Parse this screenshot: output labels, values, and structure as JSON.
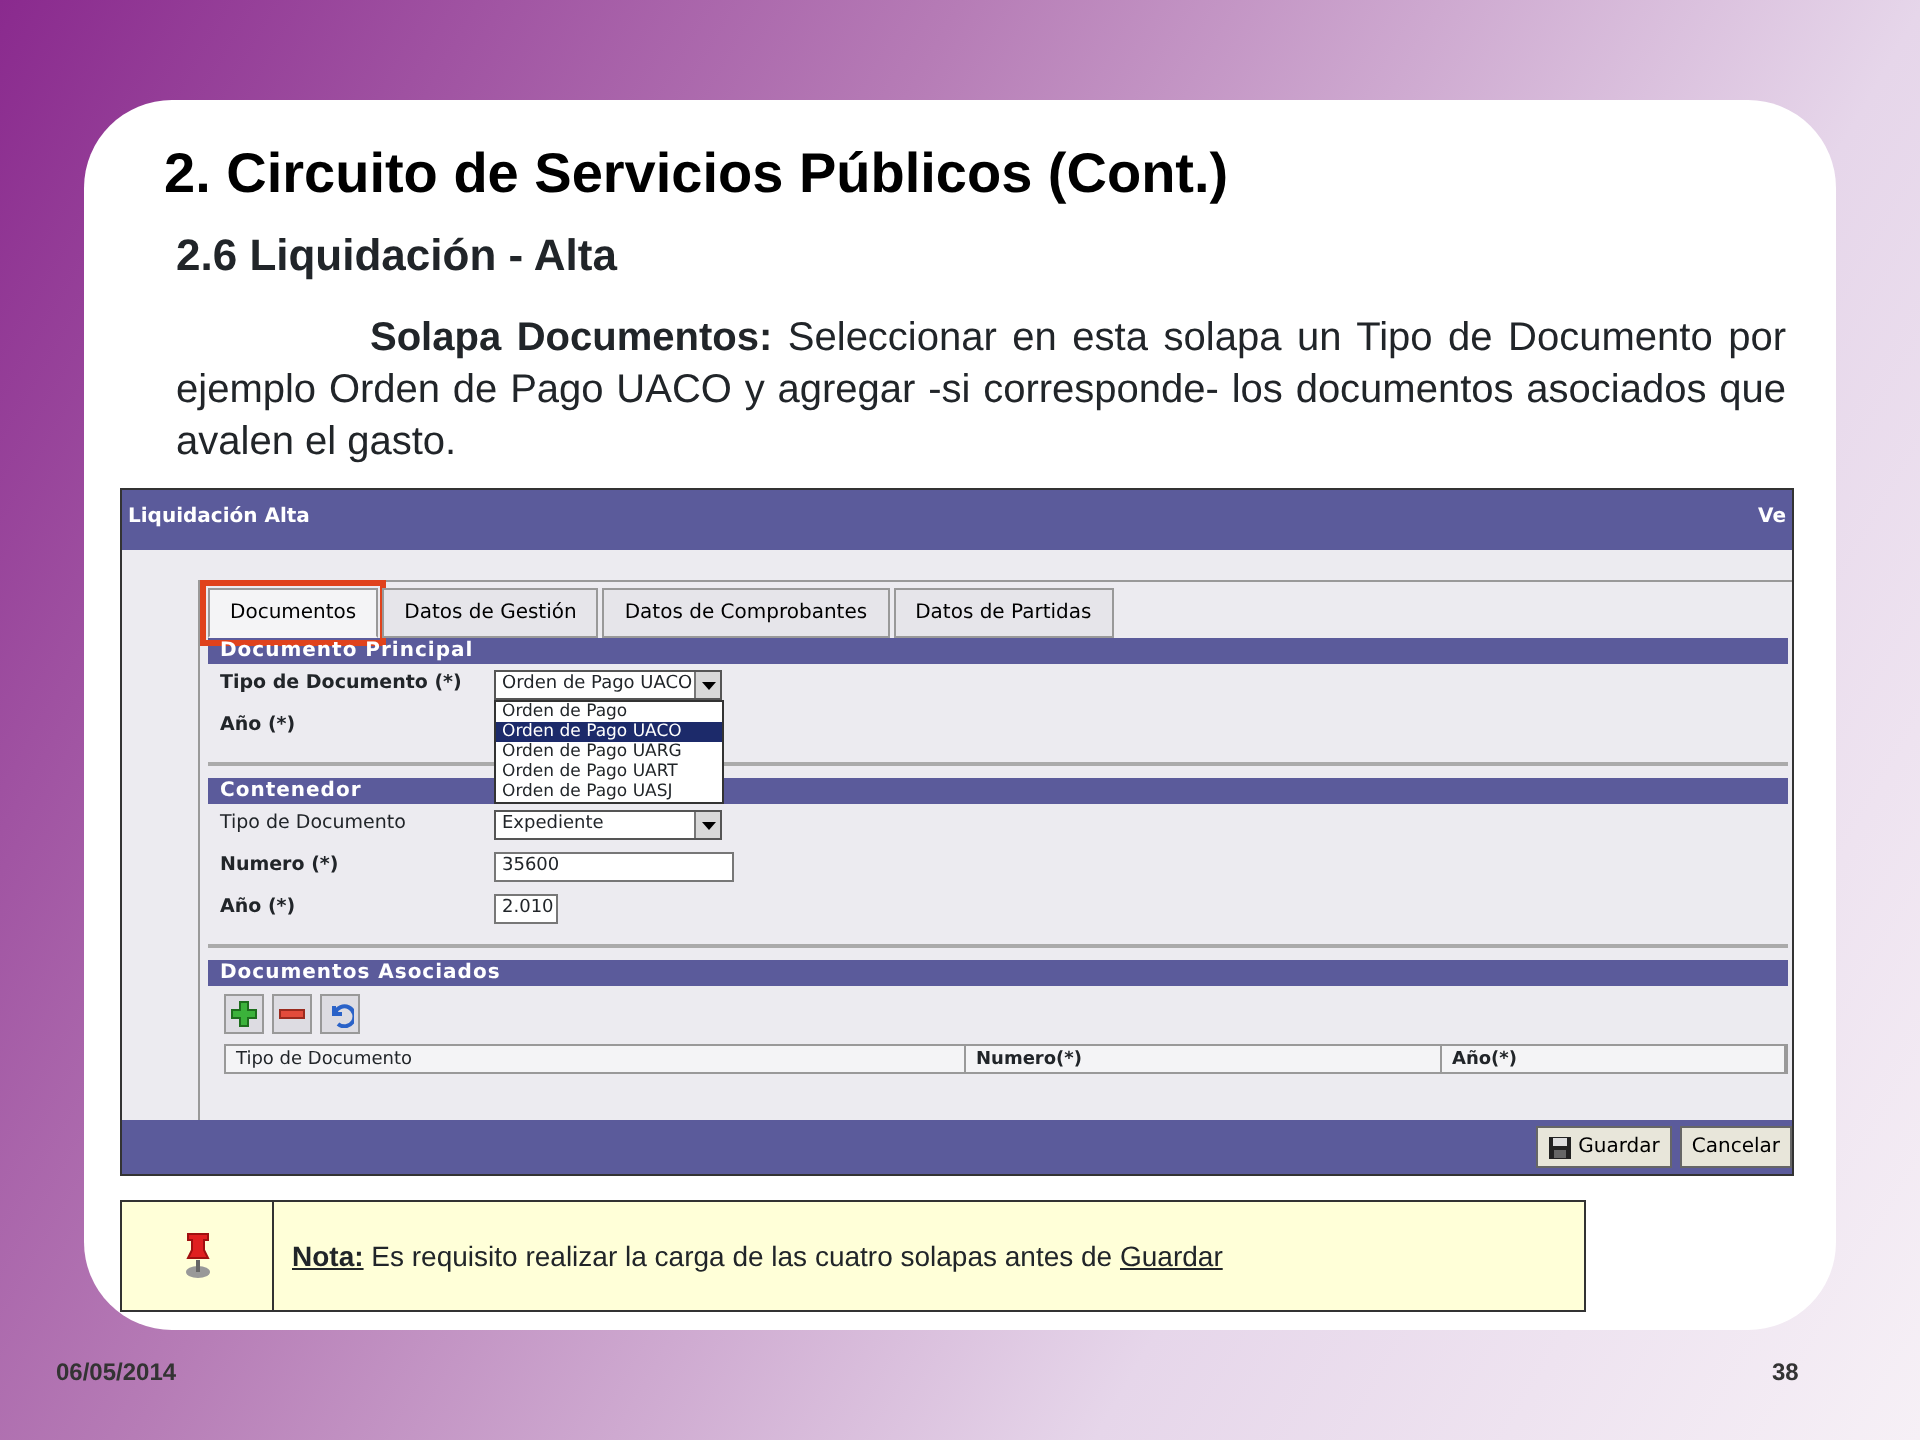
{
  "slide": {
    "title": "2. Circuito de Servicios Públicos (Cont.)",
    "subtitle": "2.6 Liquidación - Alta",
    "paragraph": "**Solapa Documentos:** Seleccionar en esta solapa un Tipo de Documento por ejemplo Orden de Pago UACO y agregar -si corresponde- los documentos asociados que avalen el gasto."
  },
  "app": {
    "title": "Liquidación Alta",
    "title_right": "Ve",
    "tabs": [
      {
        "label": "Documentos",
        "selected": true,
        "highlighted": true
      },
      {
        "label": "Datos de Gestión",
        "selected": false,
        "highlighted": false
      },
      {
        "label": "Datos de Comprobantes",
        "selected": false,
        "highlighted": false
      },
      {
        "label": "Datos de Partidas",
        "selected": false,
        "highlighted": false
      }
    ],
    "documento_principal": {
      "header": "Documento Principal",
      "fields": [
        {
          "kind": "select",
          "label": "Tipo de Documento (*)",
          "bold": true,
          "value": "Orden de Pago UACO",
          "open": true,
          "options": [
            {
              "label": "Orden de Pago",
              "selected": false
            },
            {
              "label": "Orden de Pago UACO",
              "selected": true
            },
            {
              "label": "Orden de Pago UARG",
              "selected": false
            },
            {
              "label": "Orden de Pago UART",
              "selected": false
            },
            {
              "label": "Orden de Pago UASJ",
              "selected": false
            }
          ]
        },
        {
          "kind": "empty",
          "label": "Año (*)",
          "bold": true
        }
      ]
    },
    "contenedor": {
      "header": "Contenedor",
      "fields": [
        {
          "kind": "select",
          "label": "Tipo de Documento",
          "bold": false,
          "value": "Expediente",
          "open": false
        },
        {
          "kind": "input",
          "label": "Numero (*)",
          "bold": true,
          "value": "35600"
        },
        {
          "kind": "input",
          "label": "Año (*)",
          "bold": true,
          "value": "2.010"
        }
      ]
    },
    "documentos_asociados": {
      "header": "Documentos Asociados",
      "toolbar": [
        {
          "kind": "add"
        },
        {
          "kind": "remove"
        },
        {
          "kind": "undo"
        }
      ],
      "columns": [
        {
          "label": "Tipo de Documento",
          "bold": false
        },
        {
          "label": "Numero(*)",
          "bold": true
        },
        {
          "label": "Año(*)",
          "bold": true
        }
      ]
    },
    "buttons": [
      {
        "kind": "save",
        "label": "Guardar"
      },
      {
        "kind": "cancel",
        "label": "Cancelar"
      }
    ]
  },
  "note": {
    "label": "Nota:",
    "text": "Es requisito realizar la carga de las cuatro solapas antes de",
    "link": "Guardar"
  },
  "footer": {
    "date": "06/05/2014",
    "page_number": "38"
  }
}
